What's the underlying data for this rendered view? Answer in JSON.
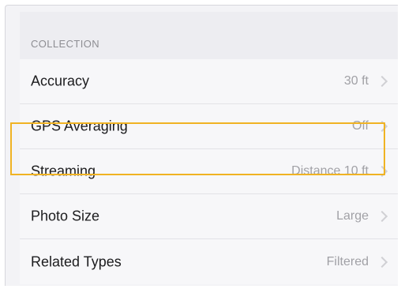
{
  "section": {
    "header": "COLLECTION"
  },
  "rows": [
    {
      "label": "Accuracy",
      "value": "30 ft",
      "chevron_icon": "chevron-right-icon"
    },
    {
      "label": "GPS Averaging",
      "value": "Off",
      "chevron_icon": "chevron-right-icon"
    },
    {
      "label": "Streaming",
      "value": "Distance 10 ft",
      "chevron_icon": "chevron-right-icon"
    },
    {
      "label": "Photo Size",
      "value": "Large",
      "chevron_icon": "chevron-right-icon"
    },
    {
      "label": "Related Types",
      "value": "Filtered",
      "chevron_icon": "chevron-right-icon"
    }
  ],
  "colors": {
    "highlight": "#f0b323",
    "label_text": "#1c1c1e",
    "value_text": "#a1a1a6",
    "header_text": "#8e8e93"
  }
}
